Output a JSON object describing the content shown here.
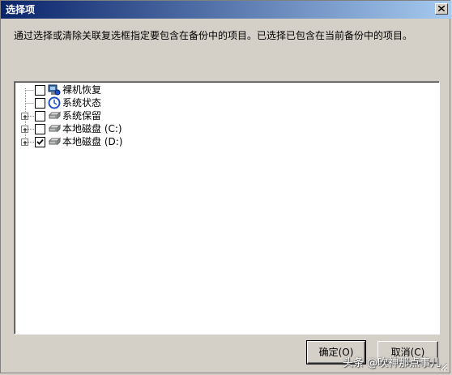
{
  "window": {
    "title": "选择项"
  },
  "instruction": "通过选择或清除关联复选框指定要包含在备份中的项目。已选择已包含在当前备份中的项目。",
  "tree": {
    "items": [
      {
        "label": "裸机恢复",
        "checked": false,
        "expandable": false,
        "icon": "bare-metal-recovery-icon"
      },
      {
        "label": "系统状态",
        "checked": false,
        "expandable": false,
        "icon": "system-state-icon"
      },
      {
        "label": "系统保留",
        "checked": false,
        "expandable": true,
        "icon": "drive-icon"
      },
      {
        "label": "本地磁盘 (C:)",
        "checked": false,
        "expandable": true,
        "icon": "drive-icon"
      },
      {
        "label": "本地磁盘 (D:)",
        "checked": true,
        "expandable": true,
        "icon": "drive-icon"
      }
    ]
  },
  "buttons": {
    "ok_label": "确定(O)",
    "cancel_label": "取消(C)"
  },
  "watermark": "头条 @吹神那点事儿"
}
